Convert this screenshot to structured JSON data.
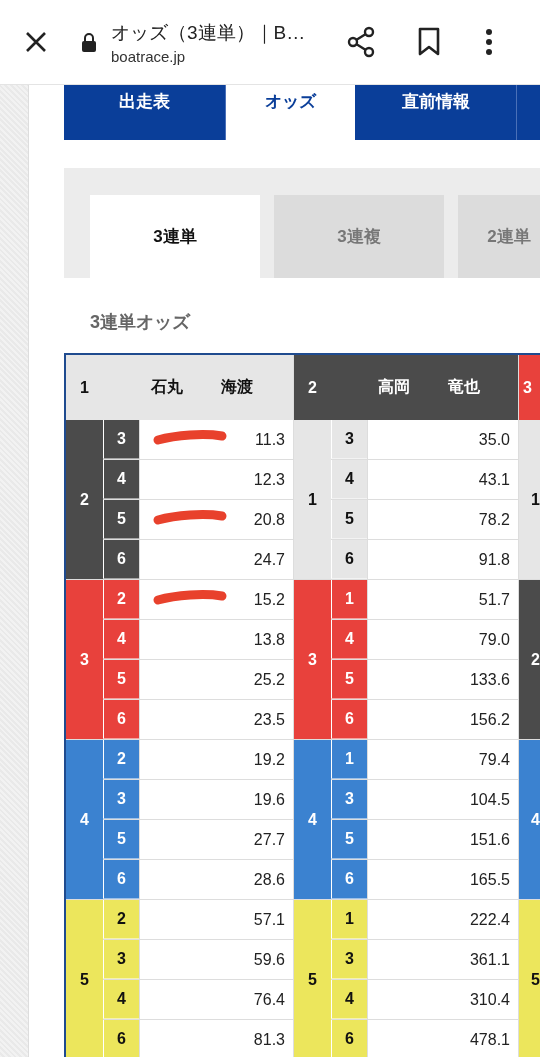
{
  "browser_bar": {
    "title": "オッズ（3連単）｜B…",
    "url": "boatrace.jp"
  },
  "nav_tabs": [
    {
      "label": "出走表",
      "selected": false
    },
    {
      "label": "オッズ",
      "selected": true
    },
    {
      "label": "直前情報",
      "selected": false
    }
  ],
  "bet_tabs": [
    {
      "label": "3連単",
      "selected": true
    },
    {
      "label": "3連複",
      "selected": false
    },
    {
      "label": "2連単",
      "selected": false
    }
  ],
  "heading": "3連単オッズ",
  "odds_table": {
    "groups": [
      {
        "boat": "1",
        "color": "#e6e6e6",
        "name": [
          "石丸",
          "海渡"
        ],
        "blocks": [
          {
            "second": "2",
            "color": "#4b4b4b",
            "rows": [
              {
                "third": "3",
                "odds": "11.3",
                "scribbled": true
              },
              {
                "third": "4",
                "odds": "12.3",
                "scribbled": false
              },
              {
                "third": "5",
                "odds": "20.8",
                "scribbled": true
              },
              {
                "third": "6",
                "odds": "24.7",
                "scribbled": false
              }
            ]
          },
          {
            "second": "3",
            "color": "#e8413c",
            "rows": [
              {
                "third": "2",
                "odds": "15.2",
                "scribbled": true
              },
              {
                "third": "4",
                "odds": "13.8",
                "scribbled": false
              },
              {
                "third": "5",
                "odds": "25.2",
                "scribbled": false
              },
              {
                "third": "6",
                "odds": "23.5",
                "scribbled": false
              }
            ]
          },
          {
            "second": "4",
            "color": "#3b82d0",
            "rows": [
              {
                "third": "2",
                "odds": "19.2",
                "scribbled": false
              },
              {
                "third": "3",
                "odds": "19.6",
                "scribbled": false
              },
              {
                "third": "5",
                "odds": "27.7",
                "scribbled": false
              },
              {
                "third": "6",
                "odds": "28.6",
                "scribbled": false
              }
            ]
          },
          {
            "second": "5",
            "color": "#ece65c",
            "rows": [
              {
                "third": "2",
                "odds": "57.1",
                "scribbled": false
              },
              {
                "third": "3",
                "odds": "59.6",
                "scribbled": false
              },
              {
                "third": "4",
                "odds": "76.4",
                "scribbled": false
              },
              {
                "third": "6",
                "odds": "81.3",
                "scribbled": false
              }
            ]
          }
        ]
      },
      {
        "boat": "2",
        "color": "#4b4b4b",
        "name": [
          "高岡",
          "竜也"
        ],
        "blocks": [
          {
            "second": "1",
            "color": "#e6e6e6",
            "rows": [
              {
                "third": "3",
                "odds": "35.0",
                "scribbled": false
              },
              {
                "third": "4",
                "odds": "43.1",
                "scribbled": false
              },
              {
                "third": "5",
                "odds": "78.2",
                "scribbled": false
              },
              {
                "third": "6",
                "odds": "91.8",
                "scribbled": false
              }
            ]
          },
          {
            "second": "3",
            "color": "#e8413c",
            "rows": [
              {
                "third": "1",
                "odds": "51.7",
                "scribbled": false
              },
              {
                "third": "4",
                "odds": "79.0",
                "scribbled": false
              },
              {
                "third": "5",
                "odds": "133.6",
                "scribbled": false
              },
              {
                "third": "6",
                "odds": "156.2",
                "scribbled": false
              }
            ]
          },
          {
            "second": "4",
            "color": "#3b82d0",
            "rows": [
              {
                "third": "1",
                "odds": "79.4",
                "scribbled": false
              },
              {
                "third": "3",
                "odds": "104.5",
                "scribbled": false
              },
              {
                "third": "5",
                "odds": "151.6",
                "scribbled": false
              },
              {
                "third": "6",
                "odds": "165.5",
                "scribbled": false
              }
            ]
          },
          {
            "second": "5",
            "color": "#ece65c",
            "rows": [
              {
                "third": "1",
                "odds": "222.4",
                "scribbled": false
              },
              {
                "third": "3",
                "odds": "361.1",
                "scribbled": false
              },
              {
                "third": "4",
                "odds": "310.4",
                "scribbled": false
              },
              {
                "third": "6",
                "odds": "478.1",
                "scribbled": false
              }
            ]
          }
        ]
      },
      {
        "boat": "3",
        "color": "#e8413c",
        "blocks": [
          {
            "second": "1",
            "color": "#e6e6e6"
          },
          {
            "second": "2",
            "color": "#4b4b4b"
          },
          {
            "second": "4",
            "color": "#3b82d0"
          },
          {
            "second": "5",
            "color": "#ece65c"
          }
        ]
      }
    ]
  }
}
